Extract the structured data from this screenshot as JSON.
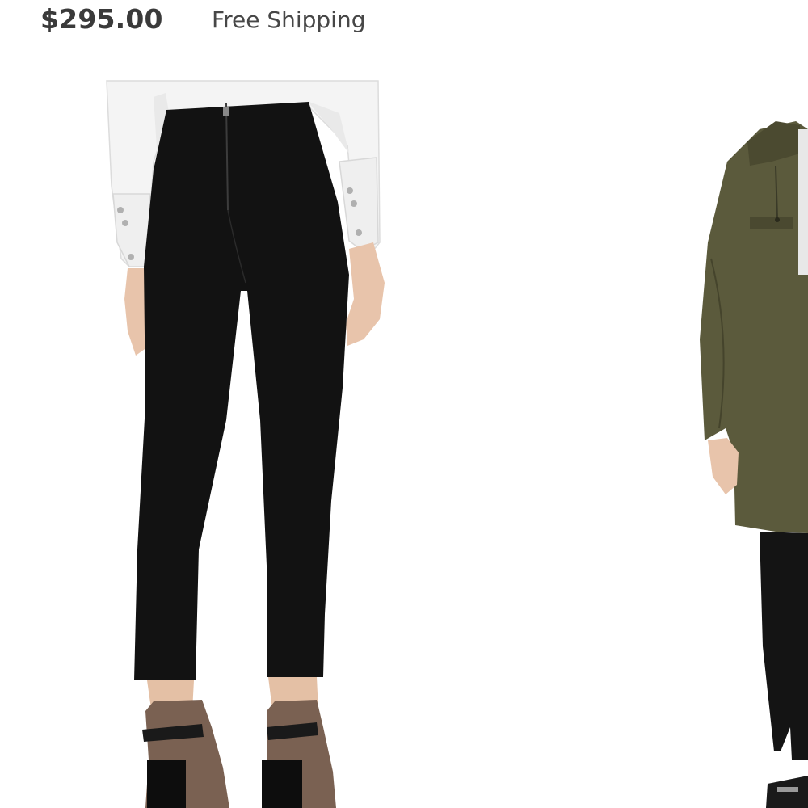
{
  "product": {
    "price": "$295.00",
    "shipping": "Free Shipping"
  },
  "gallery": {
    "images": [
      {
        "subject": "back view of black high-waist cropped pants",
        "icon": "product-photo"
      },
      {
        "subject": "olive green parka with black leggings",
        "icon": "product-photo"
      }
    ]
  },
  "colors": {
    "price_text": "#3a3a3a",
    "pants": "#121212",
    "shirt": "#f4f4f4",
    "parka": "#5b5a3c"
  }
}
